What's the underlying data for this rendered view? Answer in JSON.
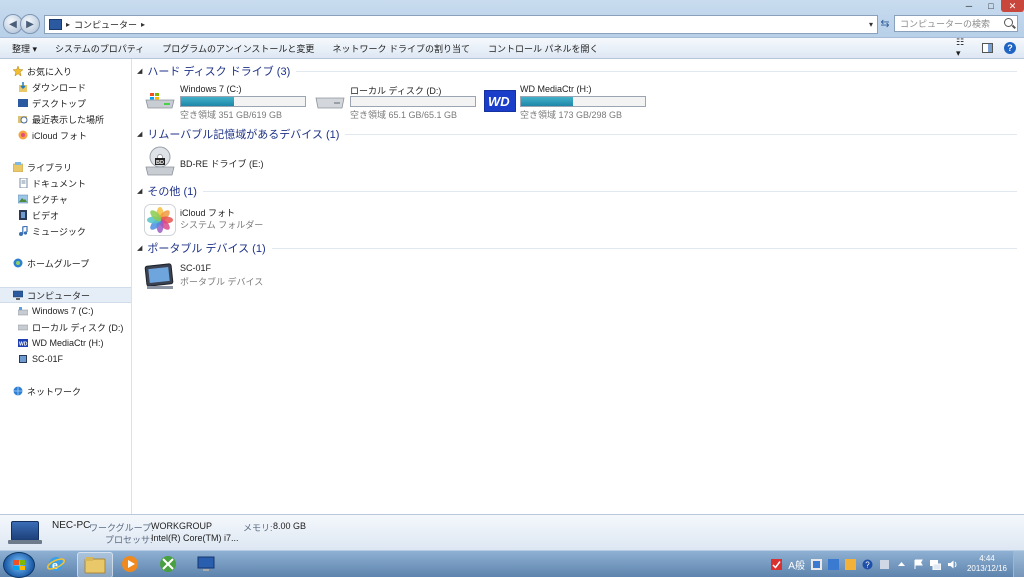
{
  "window": {
    "minimize_glyph": "─",
    "maximize_glyph": "□",
    "close_glyph": "✕"
  },
  "addressbar": {
    "breadcrumb": "コンピューター",
    "search_placeholder": "コンピューターの検索"
  },
  "commandbar": {
    "items": [
      "整理 ▾",
      "システムのプロパティ",
      "プログラムのアンインストールと変更",
      "ネットワーク ドライブの割り当て",
      "コントロール パネルを開く"
    ],
    "help_glyph": "?"
  },
  "navpane": {
    "favorites": {
      "label": "お気に入り",
      "items": [
        "ダウンロード",
        "デスクトップ",
        "最近表示した場所",
        "iCloud フォト"
      ]
    },
    "libraries": {
      "label": "ライブラリ",
      "items": [
        "ドキュメント",
        "ピクチャ",
        "ビデオ",
        "ミュージック"
      ]
    },
    "homegroup": {
      "label": "ホームグループ"
    },
    "computer": {
      "label": "コンピューター",
      "items": [
        "Windows 7 (C:)",
        "ローカル ディスク (D:)",
        "WD MediaCtr (H:)",
        "SC-01F"
      ]
    },
    "network": {
      "label": "ネットワーク"
    }
  },
  "groups": {
    "hdd": {
      "title": "ハード ディスク ドライブ (3)",
      "drives": [
        {
          "name": "Windows 7 (C:)",
          "free": "空き領域 351 GB/619 GB",
          "used_fraction": 0.43
        },
        {
          "name": "ローカル ディスク (D:)",
          "free": "空き領域 65.1 GB/65.1 GB",
          "used_fraction": 0.0
        },
        {
          "name": "WD MediaCtr (H:)",
          "free": "空き領域 173 GB/298 GB",
          "used_fraction": 0.42
        }
      ]
    },
    "removable": {
      "title": "リムーバブル記憶域があるデバイス (1)",
      "items": [
        {
          "name": "BD-RE ドライブ (E:)",
          "sub": ""
        }
      ]
    },
    "other": {
      "title": "その他 (1)",
      "items": [
        {
          "name": "iCloud フォト",
          "sub": "システム フォルダー"
        }
      ]
    },
    "portable": {
      "title": "ポータブル デバイス (1)",
      "items": [
        {
          "name": "SC-01F",
          "sub": "ポータブル デバイス"
        }
      ]
    }
  },
  "details": {
    "pc_name": "NEC-PC",
    "workgroup_label": "ワークグループ:",
    "workgroup_value": "WORKGROUP",
    "memory_label": "メモリ:",
    "memory_value": "8.00 GB",
    "processor_label": "プロセッサ:",
    "processor_value": "Intel(R) Core(TM) i7..."
  },
  "taskbar": {
    "ime_label": "A般",
    "time": "4:44",
    "date": "2013/12/16"
  },
  "colors": {
    "accent": "#1e3287",
    "bar_fill": "#1e87a8"
  }
}
